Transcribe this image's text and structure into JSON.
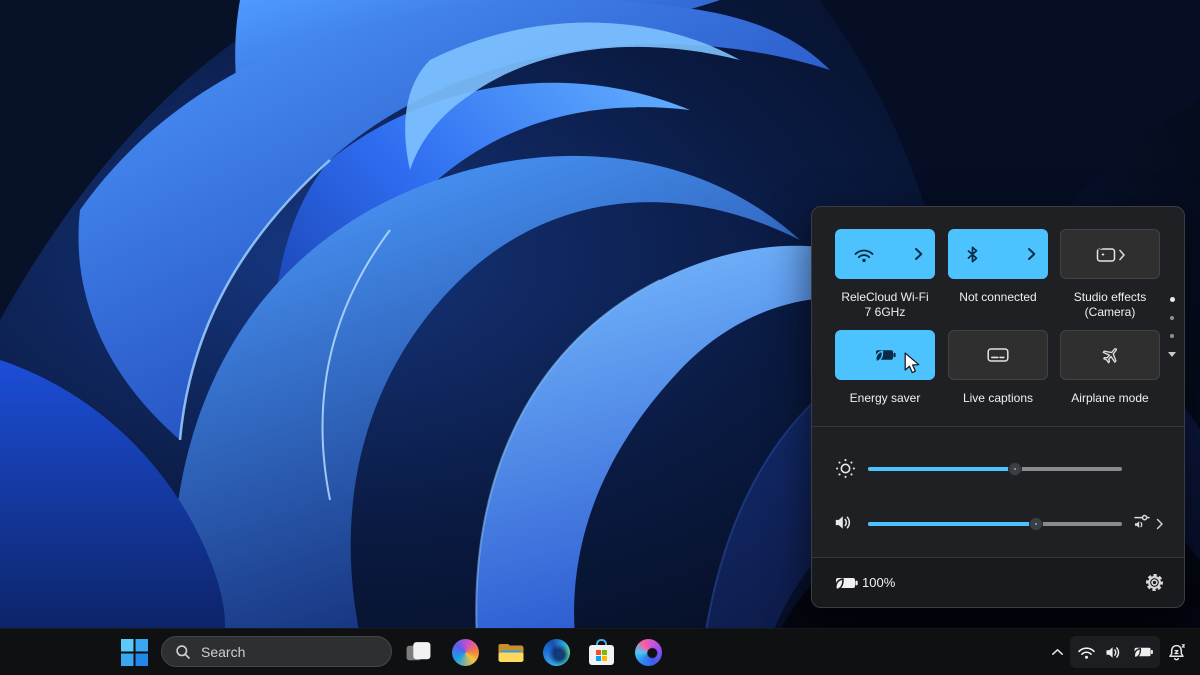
{
  "colors": {
    "accent": "#4cc2ff",
    "panel_bg": "#1f2023",
    "panel_footer_bg": "#191a1d",
    "tile_off_bg": "#2f2f2f",
    "taskbar_bg": "#0f1012",
    "slider_track_gray": "#8a8a8a",
    "wallpaper_blue": "#2f6cf0"
  },
  "quick_settings": {
    "tiles": [
      {
        "name": "wifi",
        "label": "ReleCloud Wi-Fi 7 6GHz",
        "state": "on",
        "has_expander": true
      },
      {
        "name": "bluetooth",
        "label": "Not connected",
        "state": "on",
        "has_expander": true
      },
      {
        "name": "studio-effects",
        "label": "Studio effects (Camera)",
        "state": "off",
        "has_expander": true
      },
      {
        "name": "energy-saver",
        "label": "Energy saver",
        "state": "on",
        "has_expander": false
      },
      {
        "name": "live-captions",
        "label": "Live captions",
        "state": "off",
        "has_expander": false
      },
      {
        "name": "airplane-mode",
        "label": "Airplane mode",
        "state": "off",
        "has_expander": false
      }
    ],
    "sliders": {
      "brightness": 58,
      "volume": 66
    },
    "battery_percent": "100%",
    "page_indicator": {
      "dots": 3,
      "current_page": 1,
      "more_below": true
    }
  },
  "taskbar": {
    "search_label": "Search",
    "apps": [
      "task-view",
      "copilot",
      "file-explorer",
      "edge",
      "microsoft-store",
      "microsoft-365"
    ],
    "tray": [
      "hidden-icons",
      "wifi",
      "volume",
      "battery-energy-saver",
      "do-not-disturb"
    ]
  },
  "icons": {
    "wifi-icon": "wifi signal arcs",
    "bluetooth-icon": "bluetooth rune",
    "studio-effects-icon": "camera frame with sparkles",
    "energy-saver-icon": "battery with leaf",
    "live-captions-icon": "captions box with dashes",
    "airplane-mode-icon": "airplane outline",
    "brightness-icon": "sun with dotted rays",
    "volume-icon": "speaker with sound waves",
    "sound-output-icon": "mixer slider with speaker",
    "settings-gear-icon": "gear",
    "battery-energy-saver-icon": "battery with leaf",
    "dnd-bell-icon": "bell with z",
    "hidden-icons-chevron": "chevron up",
    "search-icon": "magnifier",
    "start-icon": "windows four squares",
    "task-view-icon": "overlapping squares",
    "copilot-icon": "copilot color swirl",
    "file-explorer-icon": "yellow folder",
    "edge-icon": "edge swirl",
    "microsoft-store-icon": "shopping bag with ms logo",
    "microsoft-365-icon": "m365 swirl",
    "cursor-arrow": "pointer arrow",
    "chevron-right-icon": "chevron right",
    "page-indicator-down-arrow": "triangle down"
  }
}
